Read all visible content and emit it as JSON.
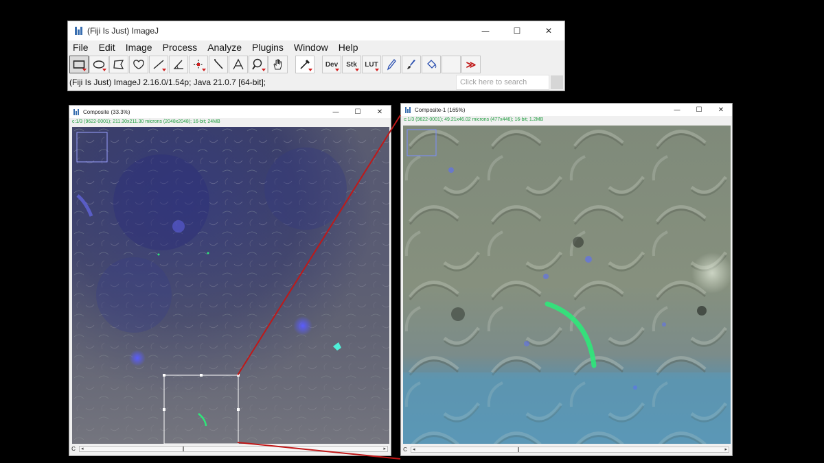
{
  "main_window": {
    "title": "(Fiji Is Just) ImageJ",
    "minimize": "—",
    "maximize": "☐",
    "close": "✕",
    "menus": [
      "File",
      "Edit",
      "Image",
      "Process",
      "Analyze",
      "Plugins",
      "Window",
      "Help"
    ],
    "tools": {
      "rectangle": "▭",
      "oval": "◯",
      "polygon": "⬠",
      "freehand": "♡",
      "line": "╱",
      "angle": "∠",
      "point": "✣",
      "wand": "⟋",
      "text": "A",
      "magnifier": "⌕",
      "hand": "✋",
      "dropper": "✎",
      "dev": "Dev",
      "stk": "Stk",
      "lut": "LUT",
      "pencil": "✏",
      "brush": "🖌",
      "flood": "⛁",
      "more": "≫"
    },
    "status": "(Fiji Is Just) ImageJ 2.16.0/1.54p; Java 21.0.7 [64-bit];",
    "search_placeholder": "Click here to search"
  },
  "left_window": {
    "title": "Composite (33.3%)",
    "info": "c:1/3 (9622-0001); 211.30x211.30 microns (2048x2048); 16-bit; 24MB",
    "scroll_label": "C",
    "minimize": "—",
    "maximize": "☐",
    "close": "✕"
  },
  "right_window": {
    "title": "Composite-1 (165%)",
    "info": "c:1/3 (9622-0001); 49.21x46.02 microns (477x446); 16-bit; 1.2MB",
    "scroll_label": "C",
    "minimize": "—",
    "maximize": "☐",
    "close": "✕"
  },
  "colors": {
    "channel_blue": "#4a4cff",
    "channel_green": "#2ee87a",
    "channel_cyan": "#3fe0c8",
    "zoom_connector": "#c01818",
    "info_text": "#1b9b3c"
  }
}
